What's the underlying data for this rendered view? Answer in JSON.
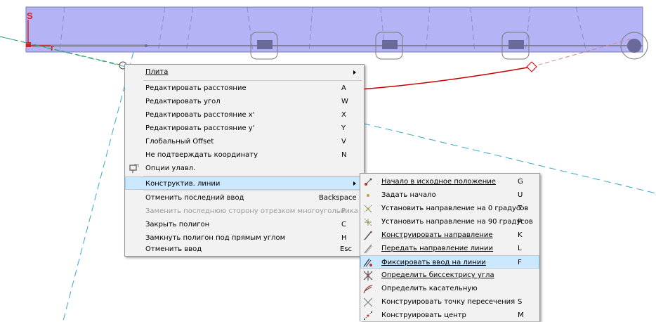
{
  "canvas": {
    "axis_s_label": "S",
    "axis_r_label": "r",
    "slab_color": "#b3b3f5",
    "curve_color": "#c80000"
  },
  "menu1": {
    "items": [
      {
        "label": "Плита",
        "shortcut": "",
        "submenu": true
      },
      {
        "label": "Редактировать расстояние",
        "shortcut": "A"
      },
      {
        "label": "Редактировать угол",
        "shortcut": "W"
      },
      {
        "label": "Редактировать расстояние x'",
        "shortcut": "X"
      },
      {
        "label": "Редактировать расстояние y'",
        "shortcut": "Y"
      },
      {
        "label": "Глобальный Offset",
        "shortcut": "V"
      },
      {
        "label": "Не подтверждать координату",
        "shortcut": "N"
      },
      {
        "label": "Опции улавл.",
        "shortcut": "",
        "icon": "snap-options-icon"
      },
      {
        "label": "Конструктив. линии",
        "shortcut": "",
        "submenu": true,
        "highlighted": true
      },
      {
        "label": "Отменить последний ввод",
        "shortcut": "Backspace"
      },
      {
        "label": "Заменить последнюю сторону отрезком многоугольника",
        "shortcut": "P",
        "disabled": true
      },
      {
        "label": "Закрыть полигон",
        "shortcut": "C"
      },
      {
        "label": "Замкнуть полигон под прямым углом",
        "shortcut": "H"
      },
      {
        "label": "Отменить ввод",
        "shortcut": "Esc"
      }
    ]
  },
  "menu2": {
    "items": [
      {
        "label": "Начало в исходное положение",
        "shortcut": "G",
        "icon": "origin-reset-icon"
      },
      {
        "label": "Задать начало",
        "shortcut": "U",
        "icon": "set-origin-icon"
      },
      {
        "label": "Установить направление на 0 градусов",
        "shortcut": "T",
        "icon": "direction-0-icon"
      },
      {
        "label": "Установить направление на 90 градусов",
        "shortcut": "R",
        "icon": "direction-90-icon"
      },
      {
        "label": "Конструировать направление",
        "shortcut": "K",
        "icon": "construct-direction-icon"
      },
      {
        "label": "Передать направление линии",
        "shortcut": "L",
        "icon": "transfer-direction-icon"
      },
      {
        "label": "Фиксировать ввод на линии",
        "shortcut": "F",
        "icon": "fix-on-line-icon",
        "highlighted": true
      },
      {
        "label": "Определить биссектрису угла",
        "shortcut": "",
        "icon": "bisector-icon"
      },
      {
        "label": "Определить касательную",
        "shortcut": "",
        "icon": "tangent-icon"
      },
      {
        "label": "Конструировать точку пересечения",
        "shortcut": "S",
        "icon": "intersection-icon"
      },
      {
        "label": "Конструировать центр",
        "shortcut": "M",
        "icon": "center-icon"
      }
    ]
  }
}
